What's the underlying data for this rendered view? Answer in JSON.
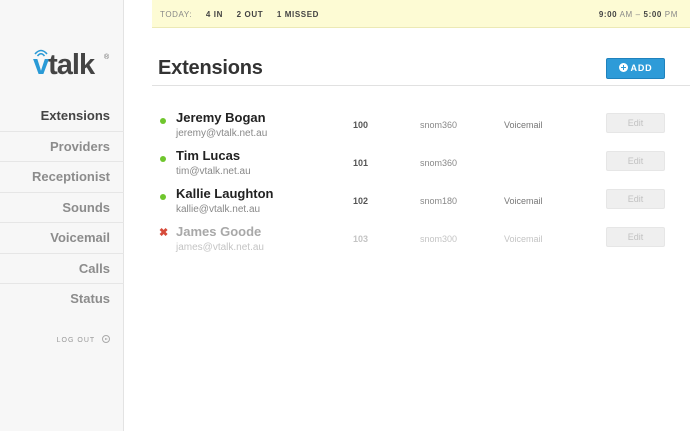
{
  "brand": {
    "name_v": "v",
    "name_rest": "talk",
    "registered": "®"
  },
  "sidebar": {
    "items": [
      {
        "label": "Extensions",
        "active": true
      },
      {
        "label": "Providers",
        "active": false
      },
      {
        "label": "Receptionist",
        "active": false
      },
      {
        "label": "Sounds",
        "active": false
      },
      {
        "label": "Voicemail",
        "active": false
      },
      {
        "label": "Calls",
        "active": false
      },
      {
        "label": "Status",
        "active": false
      }
    ],
    "logout_label": "LOG OUT"
  },
  "topbar": {
    "today_label": "TODAY:",
    "in_count": "4",
    "in_label": "IN",
    "out_count": "2",
    "out_label": "OUT",
    "missed_count": "1",
    "missed_label": "MISSED",
    "hours_start": "9:00",
    "hours_start_suffix": "AM",
    "hours_sep": "–",
    "hours_end": "5:00",
    "hours_end_suffix": "PM"
  },
  "page": {
    "title": "Extensions",
    "add_label": "ADD"
  },
  "extensions": [
    {
      "name": "Jeremy Bogan",
      "email": "jeremy@vtalk.net.au",
      "ext": "100",
      "device": "snom360",
      "voicemail": "Voicemail",
      "status": "online",
      "edit_label": "Edit"
    },
    {
      "name": "Tim Lucas",
      "email": "tim@vtalk.net.au",
      "ext": "101",
      "device": "snom360",
      "voicemail": "",
      "status": "online",
      "edit_label": "Edit"
    },
    {
      "name": "Kallie Laughton",
      "email": "kallie@vtalk.net.au",
      "ext": "102",
      "device": "snom180",
      "voicemail": "Voicemail",
      "status": "online",
      "edit_label": "Edit"
    },
    {
      "name": "James Goode",
      "email": "james@vtalk.net.au",
      "ext": "103",
      "device": "snom300",
      "voicemail": "Voicemail",
      "status": "offline",
      "edit_label": "Edit"
    }
  ],
  "colors": {
    "accent": "#2e9bd8",
    "online": "#6fc62d",
    "offline": "#d64b3a",
    "topbar_bg": "#fdfbd4"
  }
}
